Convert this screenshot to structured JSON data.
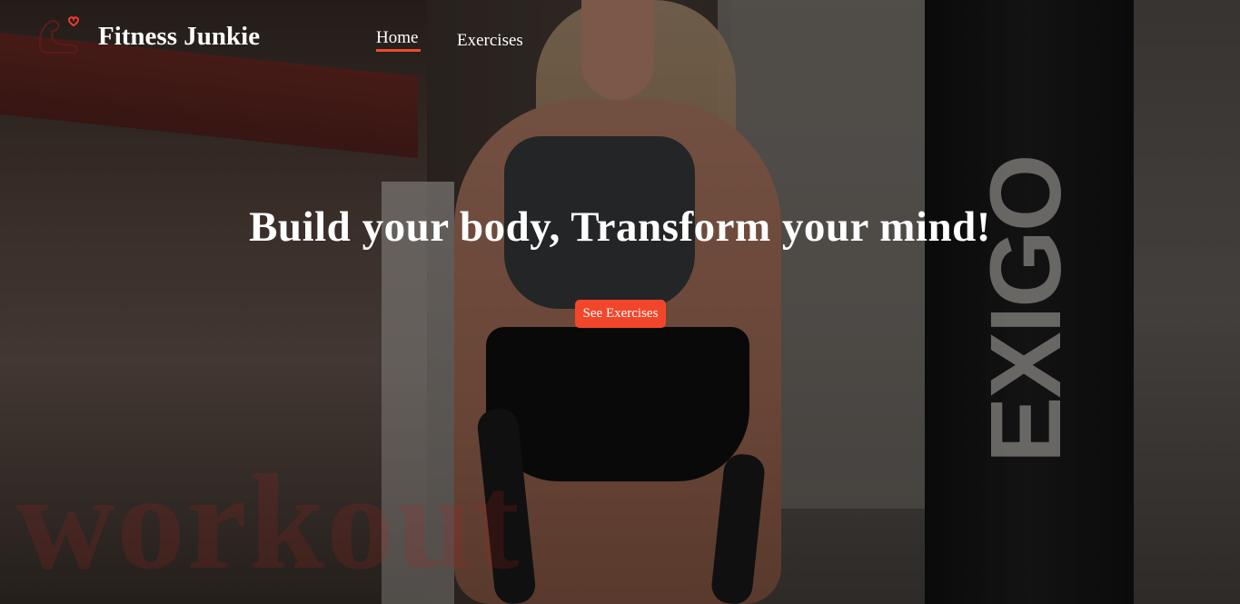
{
  "nav": {
    "brand": "Fitness Junkie",
    "logo_icon": "flexed-arm-heart-icon",
    "links": [
      {
        "label": "Home",
        "active": true
      },
      {
        "label": "Exercises",
        "active": false
      }
    ]
  },
  "hero": {
    "headline": "Build your body, Transform your mind!",
    "cta_label": "See Exercises",
    "watermark": "workout",
    "bag_logo": "EXIGO"
  },
  "colors": {
    "accent": "#f2462b",
    "text": "#ffffff",
    "watermark": "#b0241e"
  }
}
